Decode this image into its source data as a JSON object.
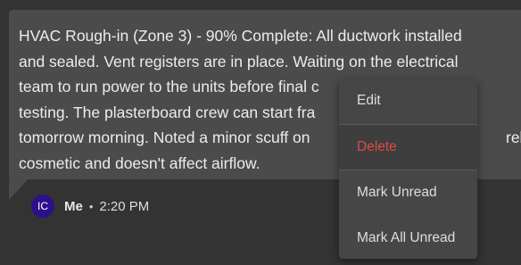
{
  "message": {
    "text": "HVAC Rough-in (Zone 3) - 90% Complete: All ductwork installed and sealed. Vent registers are in place. Waiting on the electrical team to run power to the units before final c",
    "lines": [
      "HVAC Rough-in (Zone 3) - 90% Complete: All ductwork installed",
      "and sealed. Vent registers are in place. Waiting on the electrical",
      "team to run power to the units before final c",
      "testing. The plasterboard crew can start fra",
      "tomorrow morning. Noted a minor scuff on",
      "cosmetic and doesn't affect airflow."
    ],
    "hidden_right_fragment": "rely"
  },
  "meta": {
    "avatar_initials": "IC",
    "sender": "Me",
    "separator": "•",
    "time": "2:20 PM"
  },
  "context_menu": {
    "items": [
      {
        "label": "Edit"
      },
      {
        "label": "Delete"
      },
      {
        "label": "Mark Unread"
      },
      {
        "label": "Mark All Unread"
      }
    ]
  },
  "colors": {
    "background": "#333333",
    "bubble": "#4b4b4b",
    "menu": "#464646",
    "delete": "#e04848",
    "avatar": "#2e0f8a"
  }
}
